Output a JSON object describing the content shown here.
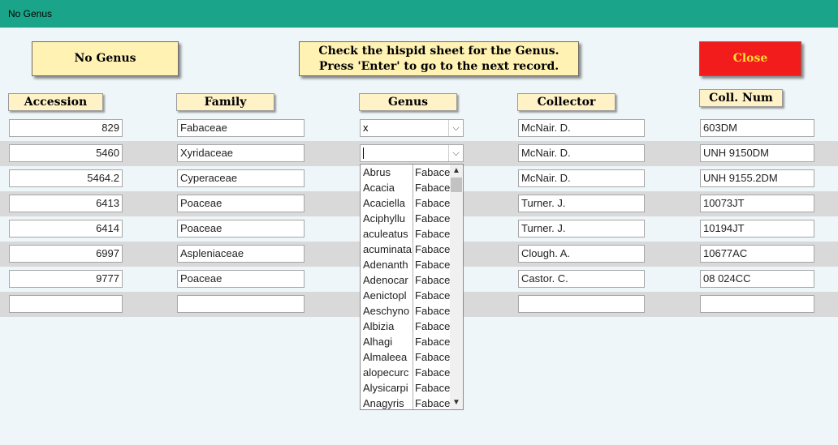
{
  "window": {
    "title": "No Genus"
  },
  "buttons": {
    "no_genus": "No Genus",
    "instruction_line1": "Check the hispid sheet for the Genus.",
    "instruction_line2": "Press 'Enter' to go to the next record.",
    "close": "Close"
  },
  "colors": {
    "titlebar": "#1aa58a",
    "close_button": "#f21c1c",
    "close_text": "#ffe033",
    "header_bg": "#fff2c7"
  },
  "columns": [
    "Accession",
    "Family",
    "Genus",
    "Collector",
    "Coll. Num"
  ],
  "rows": [
    {
      "accession": "829",
      "family": "Fabaceae",
      "genus": "x",
      "collector": "McNair. D.",
      "coll_num": "603DM"
    },
    {
      "accession": "5460",
      "family": "Xyridaceae",
      "genus": "",
      "collector": "McNair. D.",
      "coll_num": "UNH 9150DM"
    },
    {
      "accession": "5464.2",
      "family": "Cyperaceae",
      "genus": "",
      "collector": "McNair. D.",
      "coll_num": "UNH 9155.2DM"
    },
    {
      "accession": "6413",
      "family": "Poaceae",
      "genus": "",
      "collector": "Turner. J.",
      "coll_num": "10073JT"
    },
    {
      "accession": "6414",
      "family": "Poaceae",
      "genus": "",
      "collector": "Turner. J.",
      "coll_num": "10194JT"
    },
    {
      "accession": "6997",
      "family": "Aspleniaceae",
      "genus": "",
      "collector": "Clough. A.",
      "coll_num": "10677AC"
    },
    {
      "accession": "9777",
      "family": "Poaceae",
      "genus": "",
      "collector": "Castor. C.",
      "coll_num": "08 024CC"
    },
    {
      "accession": "",
      "family": "",
      "genus": "",
      "collector": "",
      "coll_num": ""
    }
  ],
  "genus_dropdown": [
    [
      "Abrus",
      "Fabace"
    ],
    [
      "Acacia",
      "Fabace"
    ],
    [
      "Acaciella",
      "Fabace"
    ],
    [
      "Aciphyllu",
      "Fabace"
    ],
    [
      "aculeatus",
      "Fabace"
    ],
    [
      "acuminata",
      "Fabace"
    ],
    [
      "Adenanth",
      "Fabace"
    ],
    [
      "Adenocar",
      "Fabace"
    ],
    [
      "Aenictopl",
      "Fabace"
    ],
    [
      "Aeschyno",
      "Fabace"
    ],
    [
      "Albizia",
      "Fabace"
    ],
    [
      "Alhagi",
      "Fabace"
    ],
    [
      "Almaleea",
      "Fabace"
    ],
    [
      "alopecurc",
      "Fabace"
    ],
    [
      "Alysicarpi",
      "Fabace"
    ],
    [
      "Anagyris",
      "Fabace"
    ]
  ],
  "icons": {
    "combo_arrow": "chevron-down-icon",
    "scroll_up": "chevron-up-icon",
    "scroll_down": "chevron-down-icon"
  }
}
